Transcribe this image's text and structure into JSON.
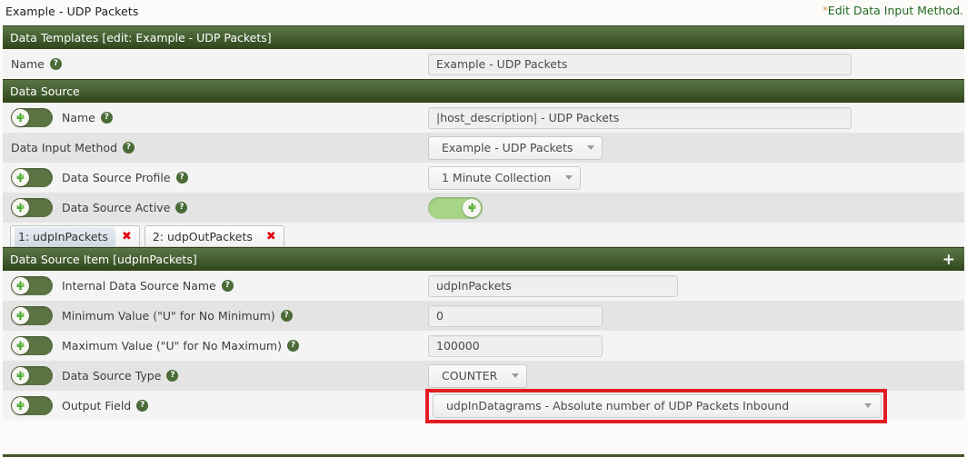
{
  "topbar": {
    "title": "Example - UDP Packets",
    "star": "*",
    "edit_link": "Edit Data Input Method."
  },
  "sections": {
    "data_templates": {
      "header": "Data Templates [edit: Example - UDP Packets]",
      "name_label": "Name",
      "name_value": "Example - UDP Packets",
      "help": "?"
    },
    "data_source": {
      "header": "Data Source",
      "rows": {
        "name_label": "Name",
        "name_value": "|host_description| - UDP Packets",
        "input_method_label": "Data Input Method",
        "input_method_value": "Example - UDP Packets",
        "profile_label": "Data Source Profile",
        "profile_value": "1 Minute Collection",
        "active_label": "Data Source Active"
      }
    },
    "data_source_item": {
      "header": "Data Source Item [udpInPackets]",
      "add_icon": "+",
      "rows": {
        "internal_name_label": "Internal Data Source Name",
        "internal_name_value": "udpInPackets",
        "minimum_label": "Minimum Value (\"U\" for No Minimum)",
        "minimum_value": "0",
        "maximum_label": "Maximum Value (\"U\" for No Maximum)",
        "maximum_value": "100000",
        "type_label": "Data Source Type",
        "type_value": "COUNTER",
        "output_field_label": "Output Field",
        "output_field_value": "udpInDatagrams - Absolute number of UDP Packets Inbound"
      }
    }
  },
  "tabs": [
    {
      "label": "1: udpInPackets",
      "close": "✖",
      "active": true
    },
    {
      "label": "2: udpOutPackets",
      "close": "✖",
      "active": false
    }
  ],
  "icons": {
    "help": "?",
    "cactus": "cactus-icon",
    "caret": "chevron-down-icon"
  },
  "colors": {
    "header_green_top": "#5b7543",
    "header_green_bottom": "#2f4419",
    "toggle_off": "#5c7444",
    "toggle_on": "#a7d487",
    "highlight_red": "#e51b23",
    "link_green": "#1e6b1e",
    "star_orange": "#c8902a"
  }
}
